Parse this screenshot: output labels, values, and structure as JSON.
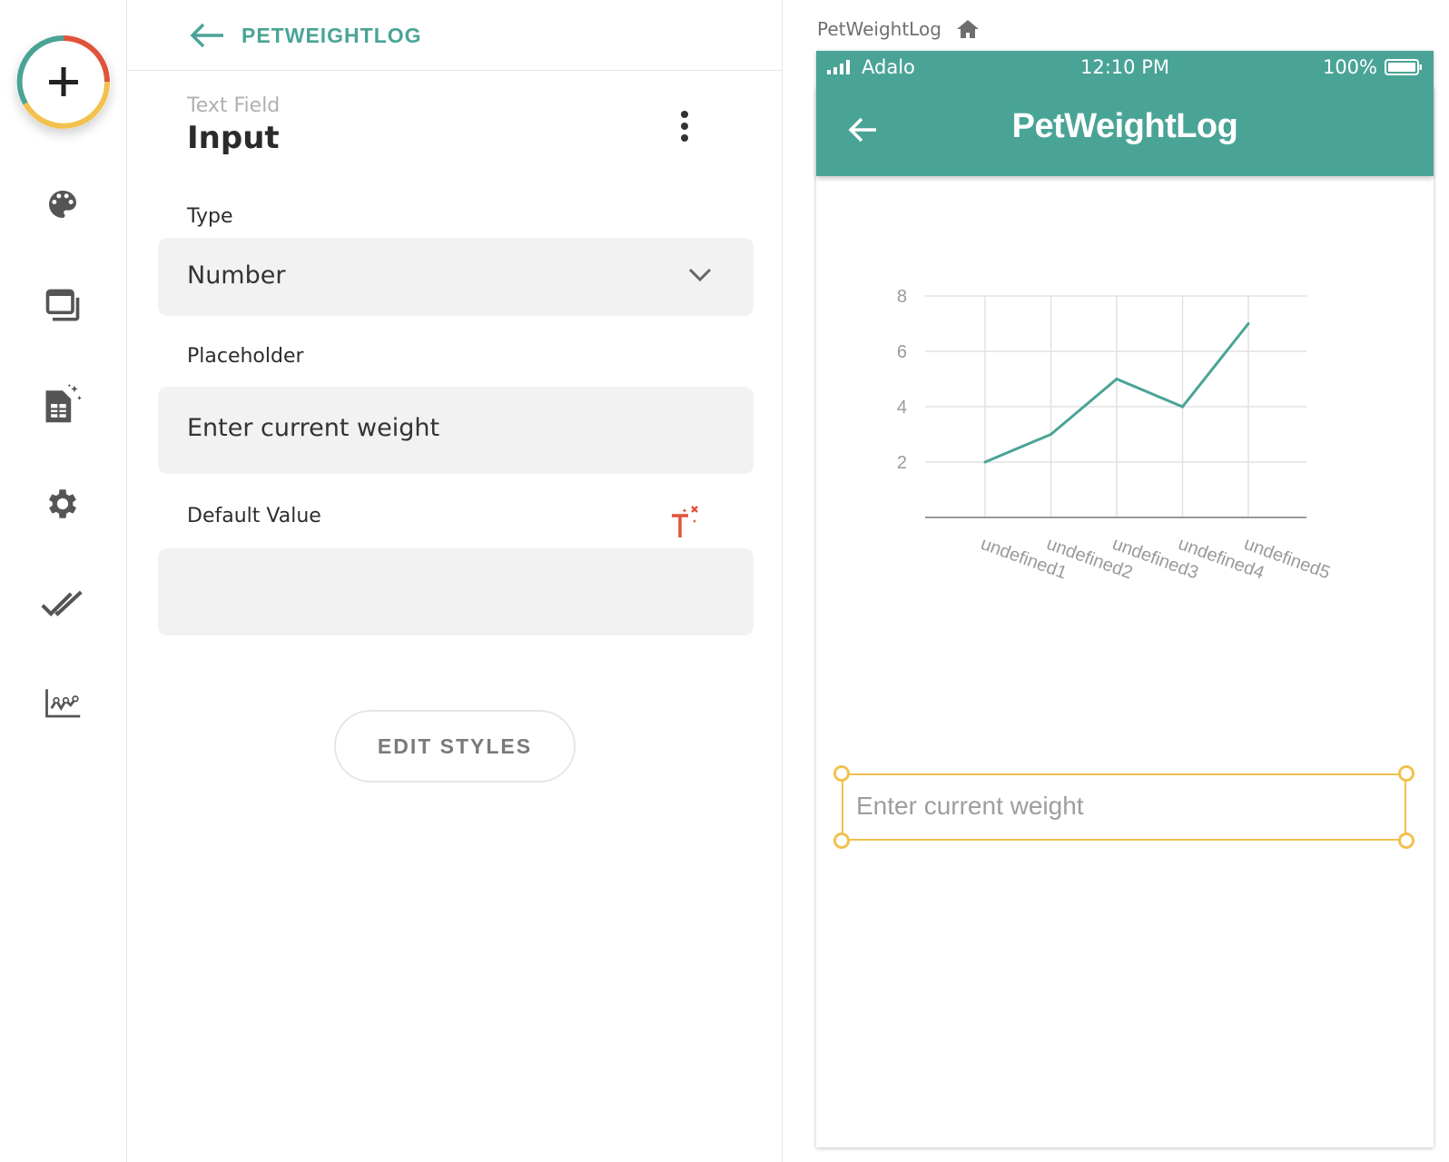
{
  "header": {
    "back_label": "back",
    "title": "PETWEIGHTLOG"
  },
  "component": {
    "kind": "Text Field",
    "name": "Input"
  },
  "fields": {
    "type_label": "Type",
    "type_value": "Number",
    "placeholder_label": "Placeholder",
    "placeholder_value": "Enter current weight",
    "default_label": "Default Value",
    "default_value": ""
  },
  "edit_styles_label": "EDIT STYLES",
  "rail_icons": [
    "add-icon",
    "palette-icon",
    "screens-icon",
    "database-icon",
    "settings-icon",
    "checklist-icon",
    "analytics-icon"
  ],
  "preview": {
    "breadcrumb": "PetWeightLog",
    "status": {
      "carrier": "Adalo",
      "time": "12:10 PM",
      "battery": "100%"
    },
    "app_title": "PetWeightLog",
    "input_placeholder": "Enter current weight"
  },
  "colors": {
    "accent": "#4aa496",
    "selection": "#f2c14e",
    "magic": "#e0523a"
  },
  "chart_data": {
    "type": "line",
    "categories": [
      "undefined1",
      "undefined2",
      "undefined3",
      "undefined4",
      "undefined5"
    ],
    "values": [
      2,
      3,
      5,
      4,
      7
    ],
    "ylim": [
      0,
      8
    ],
    "yticks": [
      2,
      4,
      6,
      8
    ],
    "grid": true,
    "title": "",
    "xlabel": "",
    "ylabel": ""
  }
}
